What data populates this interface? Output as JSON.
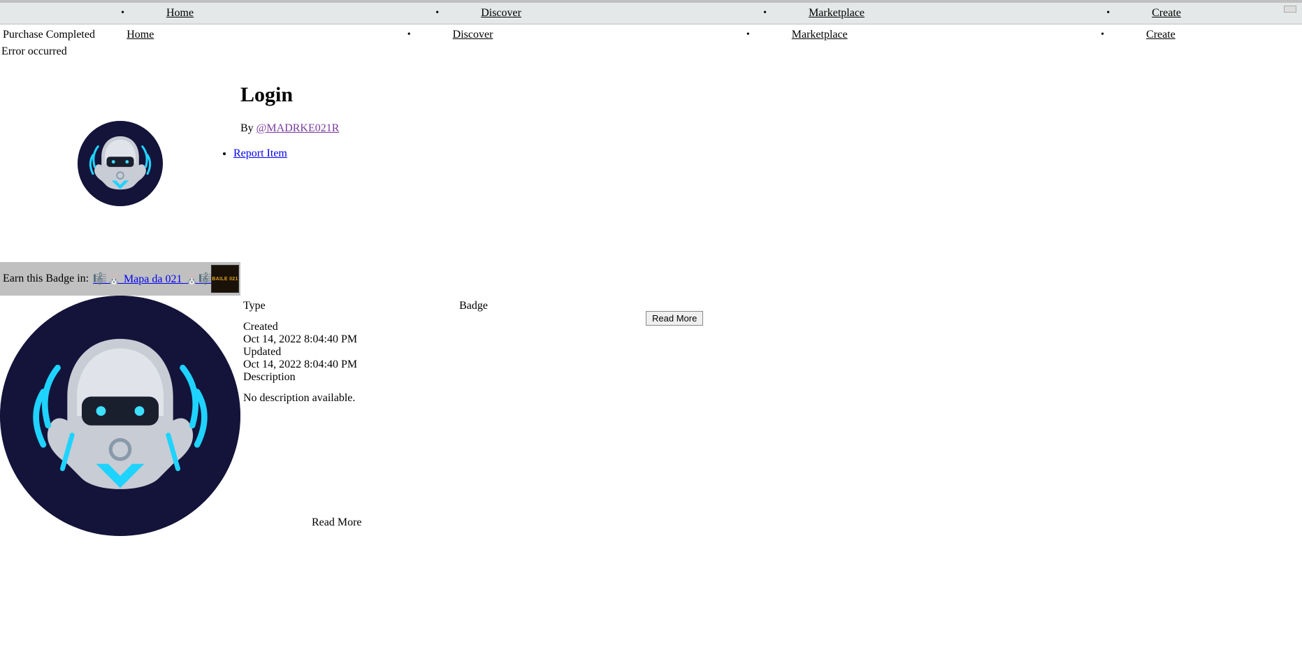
{
  "nav": {
    "items": [
      "Home",
      "Discover",
      "Marketplace",
      "Create"
    ]
  },
  "status": {
    "purchase": "Purchase Completed",
    "error": "Error occurred"
  },
  "item": {
    "title": "Login",
    "by_prefix": "By ",
    "author_handle": "@MADRKE021R",
    "report_label": "Report Item"
  },
  "earn": {
    "prefix": "Earn this Badge in: ",
    "link_text": "🎼🐰 Mapa da 021 🐰🎼",
    "badge_thumb_text": "BAILE 021"
  },
  "meta": {
    "type_label": "Type",
    "type_value": "Badge",
    "created_label": "Created",
    "created_value": "Oct 14, 2022 8:04:40 PM",
    "updated_label": "Updated",
    "updated_value": "Oct 14, 2022 8:04:40 PM",
    "description_label": "Description",
    "description_value": "No description available.",
    "read_more": "Read More"
  }
}
